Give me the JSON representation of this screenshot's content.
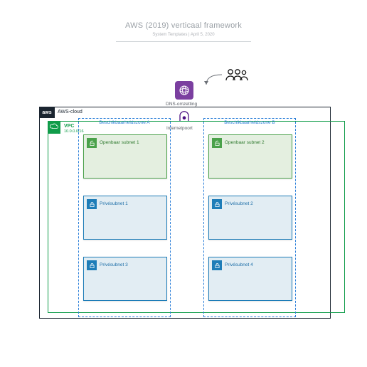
{
  "header": {
    "title": "AWS (2019) verticaal framework",
    "author": "System Templates",
    "date": "April 5, 2020",
    "separator": " | "
  },
  "icons": {
    "users": "users-icon",
    "route53": "route53-icon",
    "igw": "internet-gateway-icon",
    "aws": "aws-cloud-icon",
    "vpc": "vpc-icon",
    "lock_open": "lock-open-icon",
    "lock_closed": "lock-closed-icon"
  },
  "dns_label": "DNS-omzetting",
  "igw_label": "Internetpoort",
  "aws_cloud": {
    "badge": "aws",
    "label": "AWS-cloud"
  },
  "vpc": {
    "label": "VPC",
    "cidr": "10.0.0.0/16"
  },
  "az": {
    "a": {
      "title": "Beschikbaarheidszone A",
      "subnets": [
        {
          "kind": "pub",
          "label": "Openbaar subnet 1"
        },
        {
          "kind": "priv",
          "label": "Privésubnet 1"
        },
        {
          "kind": "priv",
          "label": "Privésubnet 3"
        }
      ]
    },
    "b": {
      "title": "Beschikbaarheidszone B",
      "subnets": [
        {
          "kind": "pub",
          "label": "Openbaar subnet 2"
        },
        {
          "kind": "priv",
          "label": "Privésubnet 2"
        },
        {
          "kind": "priv",
          "label": "Privésubnet 4"
        }
      ]
    }
  },
  "colors": {
    "cloud_border": "#1b2530",
    "vpc_green": "#109c4a",
    "az_blue": "#2b7fd9",
    "public_green": "#4aa14a",
    "private_blue": "#1e7db8",
    "route53_purple": "#7b3fa0"
  }
}
